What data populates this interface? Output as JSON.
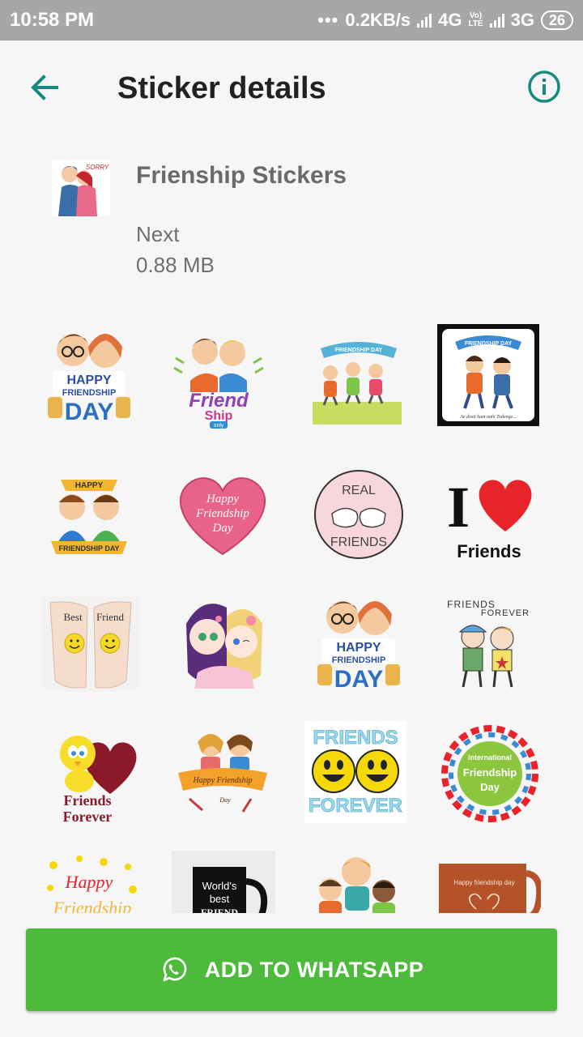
{
  "status_bar": {
    "time": "10:58 PM",
    "dots": "•••",
    "speed": "0.2KB/s",
    "net1": "4G",
    "lte_top": "Vo)",
    "lte_bottom": "LTE",
    "net2": "3G",
    "battery": "26"
  },
  "header": {
    "title": "Sticker details",
    "back_icon": "arrow-back-icon",
    "info_icon": "info-icon",
    "accent": "#178a80"
  },
  "pack": {
    "name": "Frienship Stickers",
    "author": "Next",
    "size": "0.88 MB",
    "thumb_caption": "SORRY"
  },
  "stickers": [
    {
      "kind": "boys-banner",
      "lines": [
        "HAPPY",
        "FRIENDSHIP",
        "DAY"
      ]
    },
    {
      "kind": "duo-text",
      "lines": [
        "Friend",
        "Ship",
        "only"
      ]
    },
    {
      "kind": "kids-ribbon",
      "lines": [
        "FRIENDSHIP DAY"
      ]
    },
    {
      "kind": "dark-frame",
      "lines": [
        "FRIENDSHIP DAY",
        "Ae dosti hum nahi Todenge..."
      ]
    },
    {
      "kind": "boys-arch",
      "lines": [
        "HAPPY",
        "FRIENDSHIP DAY"
      ]
    },
    {
      "kind": "pink-heart",
      "lines": [
        "Happy",
        "Friendship",
        "Day"
      ]
    },
    {
      "kind": "fist-circle",
      "lines": [
        "REAL",
        "FRIENDS"
      ]
    },
    {
      "kind": "i-heart",
      "lines": [
        "I",
        "Friends"
      ]
    },
    {
      "kind": "hands",
      "lines": [
        "Best",
        "Friend"
      ]
    },
    {
      "kind": "anime-girls",
      "lines": []
    },
    {
      "kind": "boys-banner",
      "lines": [
        "HAPPY",
        "FRIENDSHIP",
        "DAY"
      ]
    },
    {
      "kind": "kids-sketch",
      "lines": [
        "FRIENDS",
        "FOREVER"
      ]
    },
    {
      "kind": "bird-heart",
      "lines": [
        "Friends",
        "Forever"
      ]
    },
    {
      "kind": "girls-ribbon",
      "lines": [
        "Happy Friendship",
        "Day"
      ]
    },
    {
      "kind": "smileys",
      "lines": [
        "FRIENDS",
        "FOREVER"
      ]
    },
    {
      "kind": "ring",
      "lines": [
        "International",
        "Friendship",
        "Day"
      ]
    },
    {
      "kind": "smiley-text",
      "lines": [
        "Happy",
        "Friendship"
      ]
    },
    {
      "kind": "mug",
      "lines": [
        "World's",
        "best",
        "FRIEND"
      ]
    },
    {
      "kind": "kids-group",
      "lines": []
    },
    {
      "kind": "brown-mug",
      "lines": [
        "Happy friendship day"
      ]
    }
  ],
  "button": {
    "label": "ADD TO WHATSAPP",
    "icon": "whatsapp-icon",
    "color": "#4dba3b"
  }
}
